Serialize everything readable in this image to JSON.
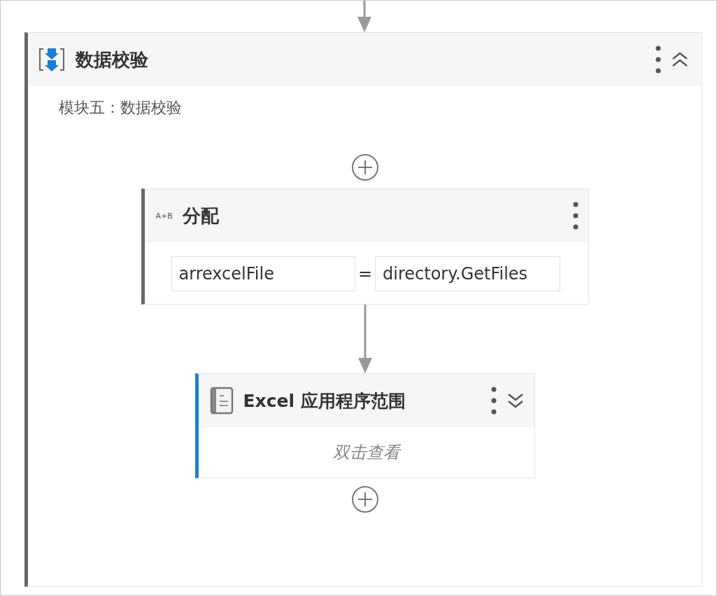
{
  "sequence": {
    "title": "数据校验",
    "selected": false,
    "expanded": true,
    "annotation": "模块五：数据校验",
    "activities": [
      {
        "kind": "assign",
        "title": "分配",
        "selected": false,
        "icon_label": "A+B",
        "to": "arrexcelFile",
        "operator": "=",
        "value": "directory.GetFiles"
      },
      {
        "kind": "scope",
        "title": "Excel 应用程序范围",
        "selected": true,
        "expanded": false,
        "hint": "双击查看"
      }
    ]
  }
}
